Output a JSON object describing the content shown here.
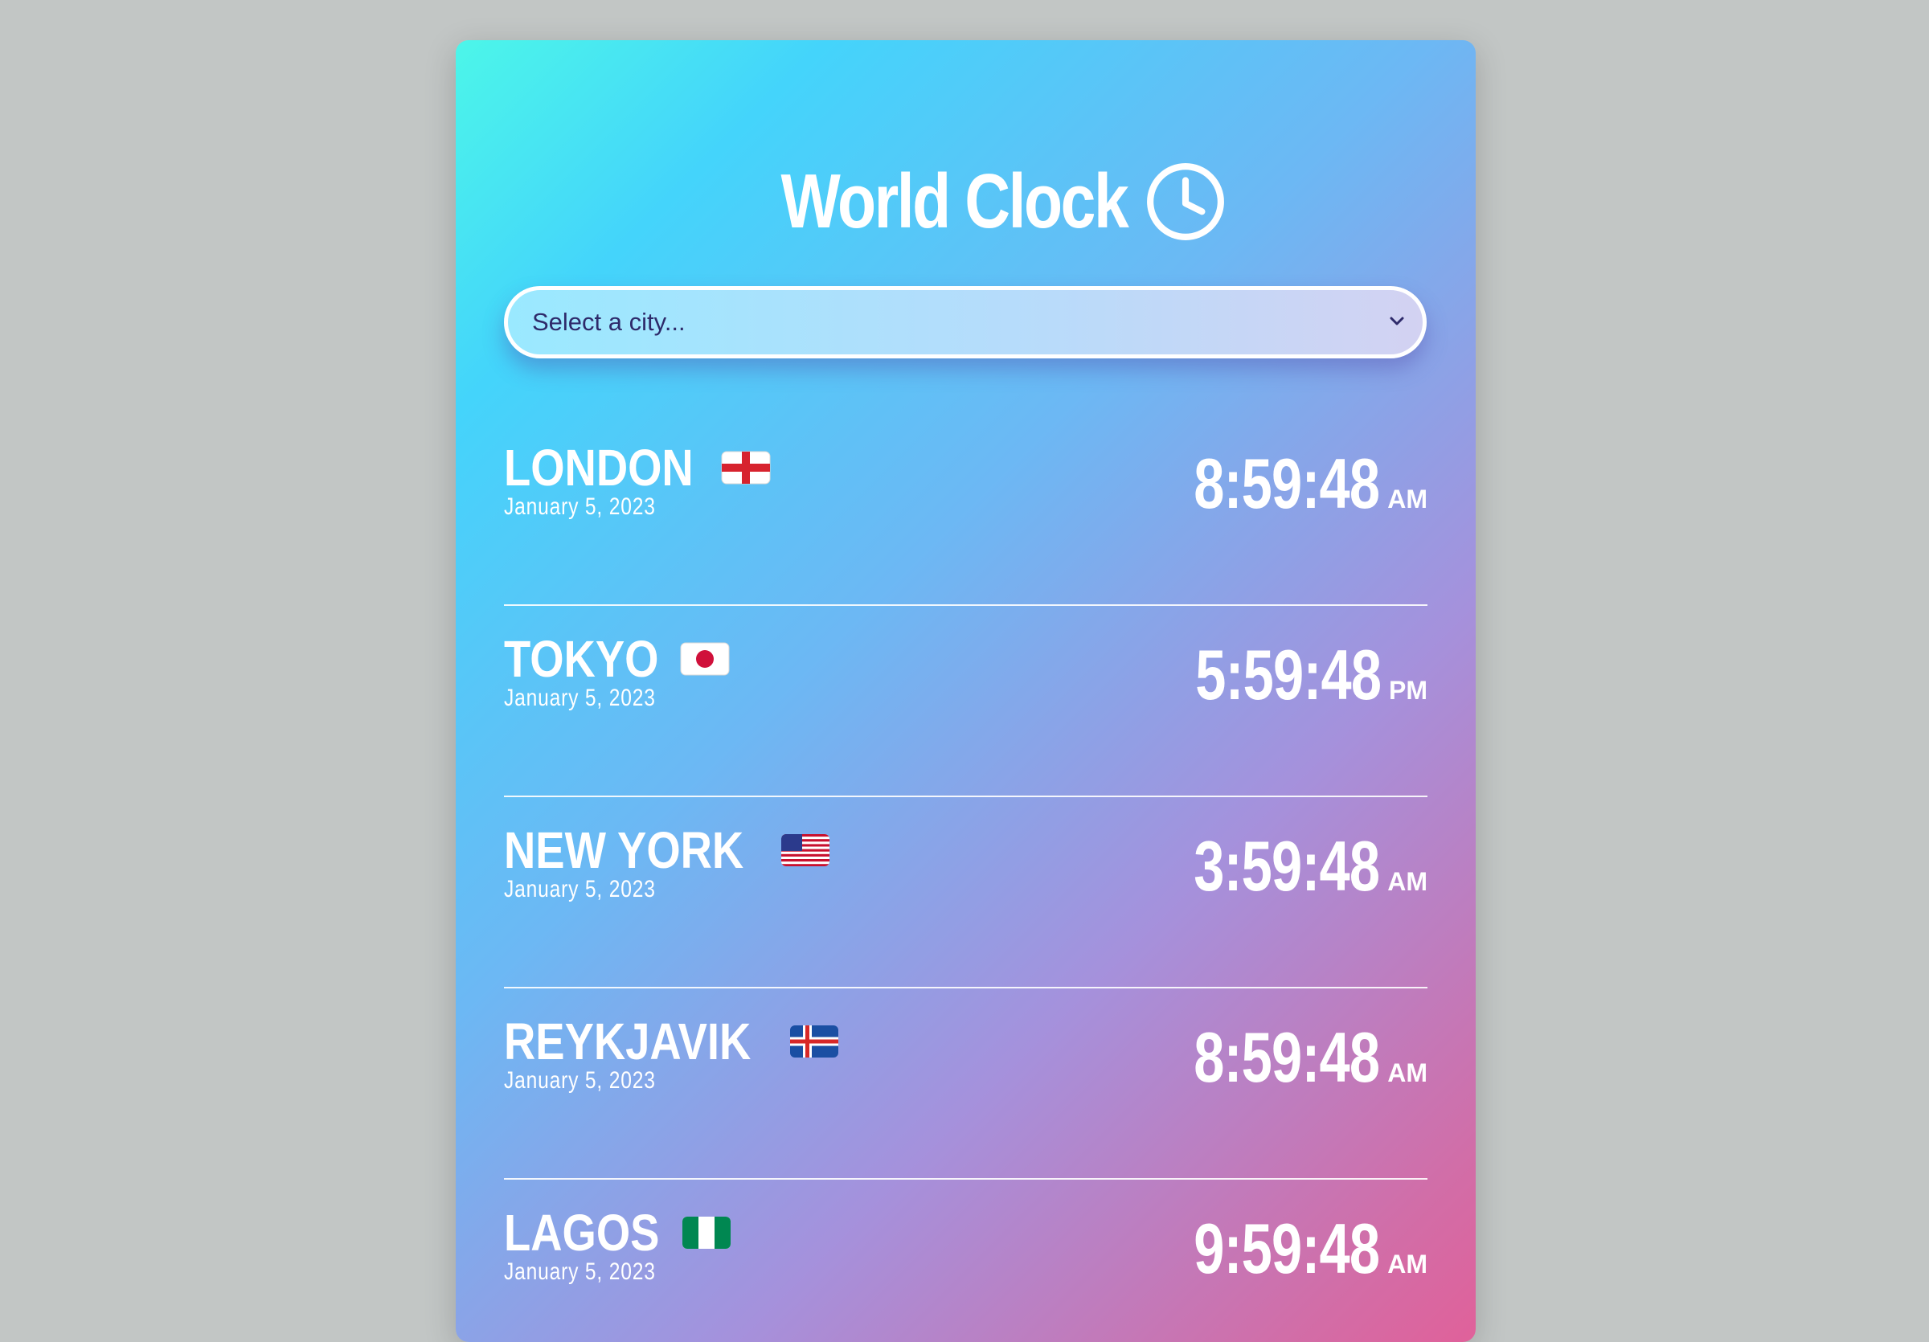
{
  "app": {
    "title": "World Clock",
    "title_icon": "clock-icon"
  },
  "city_select": {
    "placeholder": "Select a city...",
    "icon": "chevron-down-icon"
  },
  "cities": [
    {
      "name": "LONDON",
      "flag": "england-flag",
      "date": "January 5, 2023",
      "time": "8:59:48",
      "ampm": "AM"
    },
    {
      "name": "TOKYO",
      "flag": "japan-flag",
      "date": "January 5, 2023",
      "time": "5:59:48",
      "ampm": "PM"
    },
    {
      "name": "NEW YORK",
      "flag": "usa-flag",
      "date": "January 5, 2023",
      "time": "3:59:48",
      "ampm": "AM"
    },
    {
      "name": "REYKJAVIK",
      "flag": "iceland-flag",
      "date": "January 5, 2023",
      "time": "8:59:48",
      "ampm": "AM"
    },
    {
      "name": "LAGOS",
      "flag": "nigeria-flag",
      "date": "January 5, 2023",
      "time": "9:59:48",
      "ampm": "AM"
    }
  ],
  "colors": {
    "page_background": "#c2c6c5",
    "gradient_start": "#4cf6e9",
    "gradient_end": "#e0619a",
    "text": "#ffffff",
    "select_text": "#2e2a6a"
  }
}
